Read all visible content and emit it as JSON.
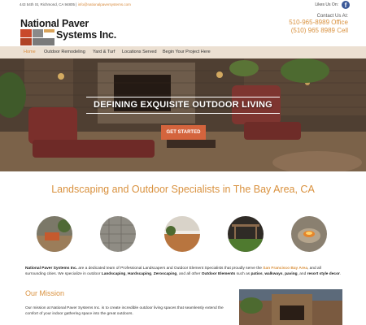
{
  "topbar": {
    "address": "443 54th St, Richmond, CA 94805",
    "email": "info@nationalpaversystems.com",
    "likes_label": "Likes Us On:",
    "social_icon": "facebook-icon"
  },
  "header": {
    "logo_line1": "National Paver",
    "logo_line2": "Systems Inc.",
    "contact_label": "Contact Us At:",
    "phone_office": "510-965-8989 Office",
    "phone_cell": "(510) 965 8989 Cell"
  },
  "nav": {
    "items": [
      "Home",
      "Outdoor Remodeling",
      "Yard & Turf",
      "Locations Served",
      "Begin Your Project Here"
    ]
  },
  "hero": {
    "title": "DEFINING EXQUISITE OUTDOOR LIVING",
    "cta_label": "GET STARTED"
  },
  "services": {
    "title": "Landscaping and Outdoor Specialists in The Bay Area, CA",
    "images": [
      "patio-furniture",
      "paver-walkway",
      "paver-patio-house",
      "pergola-yard",
      "fire-pit"
    ]
  },
  "intro": {
    "company": "National Paver Systems Inc.",
    "text1": " are a dedicated team of Professional Landscapers and Outdoor Element Specialists that proudly serve the ",
    "region": "San Francisco Bay Area",
    "text2": ", and all surrounding cities. We specialize in outdoor ",
    "s1": "Landscaping",
    "s2": "Hardscaping",
    "s3": "Zeroscaping",
    "text3": ", and all other ",
    "s4": "Outdoor Elements",
    "text4": " such as ",
    "s5": "patios",
    "s6": "walkways",
    "s7": "paving",
    "text5": ", and ",
    "s8": "resort style decor",
    "sep": ", "
  },
  "mission": {
    "title": "Our Mission",
    "text": "Our mission at National Paver Systems Inc. is to create incredible outdoor living spaces that seamlessly extend the comfort of your indoor gathering space into the great outdoors."
  },
  "colors": {
    "accent": "#d9913e",
    "nav_bg": "#ece0d2",
    "cta": "#d4643d",
    "facebook": "#3b5998"
  }
}
